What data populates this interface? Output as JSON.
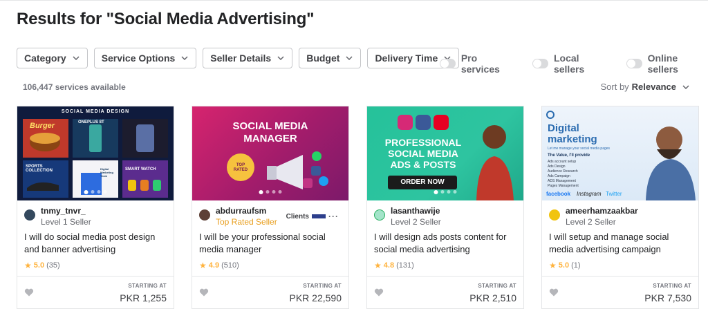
{
  "page": {
    "title": "Results for \"Social Media Advertising\"",
    "services_count": "106,447 services available",
    "sort_label": "Sort by",
    "sort_value": "Relevance"
  },
  "filters": [
    "Category",
    "Service Options",
    "Seller Details",
    "Budget",
    "Delivery Time"
  ],
  "toggles": [
    "Pro services",
    "Local sellers",
    "Online sellers"
  ],
  "cards": [
    {
      "thumb_header": "SOCIAL MEDIA DESIGN",
      "thumb_texts": [
        "Burger",
        "ONEPLUS 8T",
        "SPORTS COLLECTION",
        "Digital Marketing Team",
        "SMART WATCH"
      ],
      "seller": "tnmy_tnvr_",
      "level": "Level 1 Seller",
      "title": "I will do social media post design and banner advertising",
      "rating": "5.0",
      "reviews": "(35)",
      "starting": "STARTING AT",
      "price": "PKR 1,255"
    },
    {
      "thumb_texts": [
        "SOCIAL MEDIA",
        "MANAGER",
        "TOP",
        "RATED"
      ],
      "seller": "abdurraufsm",
      "level": "Top Rated Seller",
      "clients_label": "Clients",
      "title": "I will be your professional social media manager",
      "rating": "4.9",
      "reviews": "(510)",
      "starting": "STARTING AT",
      "price": "PKR 22,590"
    },
    {
      "thumb_texts": [
        "PROFESSIONAL",
        "SOCIAL MEDIA",
        "ADS & POSTS",
        "ORDER NOW"
      ],
      "seller": "lasanthawije",
      "level": "Level 2 Seller",
      "title": "I will design ads posts content for social media advertising",
      "rating": "4.8",
      "reviews": "(131)",
      "starting": "STARTING AT",
      "price": "PKR 2,510"
    },
    {
      "thumb_texts": [
        "Digital",
        "marketing",
        "Let me manage your social media pages",
        "The Value, I'll provide",
        "Ads account setup",
        "Ads Design",
        "Audience Research",
        "Ads Campaign",
        "ADS Management",
        "Pages Management",
        "facebook",
        "Instagram",
        "Twitter"
      ],
      "seller": "ameerhamzaakbar",
      "level": "Level 2 Seller",
      "title": "I will setup and manage social media advertising campaign",
      "rating": "5.0",
      "reviews": "(1)",
      "starting": "STARTING AT",
      "price": "PKR 7,530"
    }
  ],
  "colors": {
    "star": "#ffb33e",
    "top_rated": "#e89d1b",
    "border": "#e4e5e7"
  }
}
